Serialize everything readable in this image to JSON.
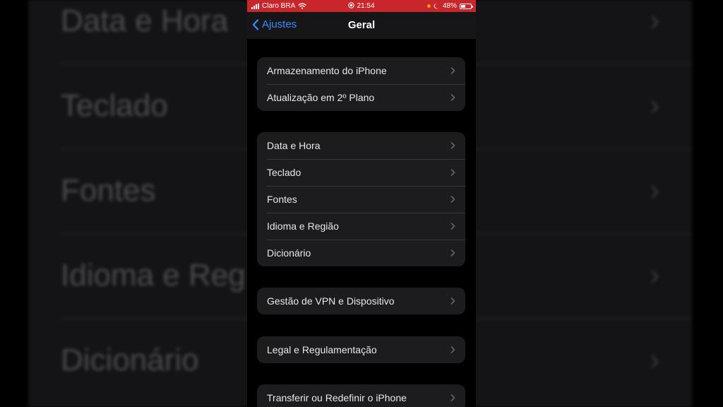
{
  "background": {
    "rows": [
      "Data e Hora",
      "Teclado",
      "Fontes",
      "Idioma e Reg",
      "Dicionário"
    ]
  },
  "statusbar": {
    "carrier": "Claro BRA",
    "time": "21:54",
    "battery": "48%",
    "battery_level": 0.48
  },
  "navbar": {
    "back_label": "Ajustes",
    "title": "Geral"
  },
  "groups": [
    {
      "items": [
        "Armazenamento do iPhone",
        "Atualização em 2º Plano"
      ]
    },
    {
      "items": [
        "Data e Hora",
        "Teclado",
        "Fontes",
        "Idioma e Região",
        "Dicionário"
      ]
    },
    {
      "items": [
        "Gestão de VPN e Dispositivo"
      ]
    },
    {
      "items": [
        "Legal e Regulamentação"
      ]
    },
    {
      "items": [
        "Transferir ou Redefinir o iPhone"
      ]
    }
  ],
  "colors": {
    "statusbar": "#c8262b",
    "accent": "#3b8bff",
    "cell_bg": "#1c1c1e"
  },
  "icons": [
    "chevron-left-icon",
    "chevron-right-icon",
    "wifi-icon",
    "signal-icon",
    "battery-icon",
    "screen-record-icon",
    "moon-icon"
  ]
}
